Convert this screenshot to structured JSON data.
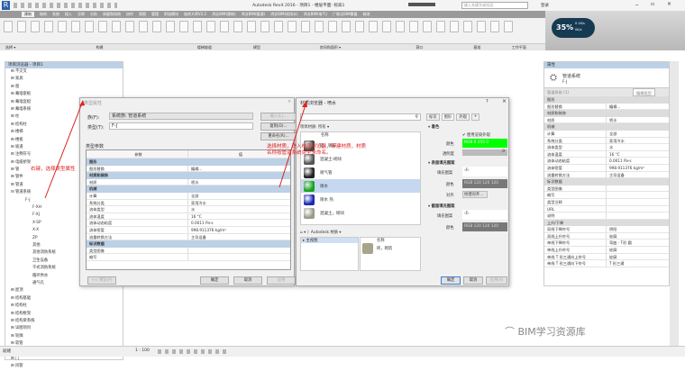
{
  "app": {
    "title": "Autodesk Revit 2016 -   项目1 - 楼层平面: 标高1",
    "search_placeholder": "键入关键字或短语",
    "user": "登录"
  },
  "ribbon": {
    "tabs": [
      "建筑",
      "结构",
      "系统",
      "插入",
      "注释",
      "分析",
      "体量和场地",
      "协作",
      "视图",
      "管理",
      "附加模块",
      "修改 | 管道",
      "族库大师V2.2",
      "鸿业BIM(建筑)",
      "鸿业BIM(暖通)",
      "鸿业BIM(给排水)",
      "鸿业BIM(电气)",
      "广联达BIM算量",
      "修改"
    ],
    "panels": [
      "选择 ▾",
      "构建",
      "楼梯坡道",
      "模型",
      "房间和面积 ▾",
      "洞口",
      "基准",
      "工作平面"
    ],
    "gauge": "35%",
    "gauge_up": "0.1K/s",
    "gauge_down": "0K/s"
  },
  "browser": {
    "title": "项目浏览器 - 项目1",
    "items": [
      "⊟ 管道系统",
      "⊞ 不交叉",
      "⊞ 家具",
      "⊞ 窗",
      "⊞ 幕墙嵌板",
      "⊞ 幕墙竖梃",
      "⊞ 幕墙系统",
      "⊞ 柱",
      "⊞ 结构柱",
      "⊞ 楼梯",
      "⊞ 楼板",
      "⊞ 坡道",
      "⊞ 注释符号",
      "⊞ 电缆桥架",
      "⊞ 管",
      "⊞ 管件",
      "⊞ 管道",
      "⊟ 管道系统"
    ],
    "sub": [
      "⊟ 管道系统",
      "F-J",
      "F-XH",
      "F-XJ",
      "X-SP",
      "X-X",
      "ZP",
      "其他",
      "其他消防系统",
      "卫生设备",
      "干式消防系统",
      "循环供水",
      "通气孔"
    ],
    "after": [
      "⊞ 屋顶",
      "⊞ 结构基础",
      "⊞ 结构柱",
      "⊞ 结构框架",
      "⊞ 结构梁系统",
      "⊞ 详图项目",
      "⊞ 轮廓",
      "⊞ 软管",
      "⊞ 软风管",
      "⊞ 门",
      "⊞ 风管"
    ]
  },
  "annotation1": "右键，选择类型属性",
  "annotation2": "选择材质，进入材质浏览器，新建材质，材质名称按管道系统类型来命名。",
  "type_dialog": {
    "title": "类型属性",
    "family_label": "族(F):",
    "family_value": "系统族: 管道系统",
    "type_label": "类型(T):",
    "type_value": "F-J",
    "load": "载入(L)...",
    "duplicate": "复制(D)...",
    "rename": "重命名(R)...",
    "params_label": "类型参数",
    "col_param": "参数",
    "col_value": "值",
    "groups": [
      {
        "name": "图形",
        "rows": [
          [
            "图形替换",
            "编辑..."
          ]
        ]
      },
      {
        "name": "材质和装饰",
        "rows": [
          [
            "材质",
            "喷水"
          ]
        ]
      },
      {
        "name": "机械",
        "rows": [
          [
            "计算",
            "全部"
          ],
          [
            "系统分类",
            "家用冷水"
          ],
          [
            "流体类型",
            "水"
          ],
          [
            "流体温度",
            "16 °C"
          ],
          [
            "流体动态粘度",
            "0.0011 Pa-s"
          ],
          [
            "流体密度",
            "998.911376 kg/m³"
          ],
          [
            "流量转换方法",
            "主导设备"
          ]
        ]
      },
      {
        "name": "标识数据",
        "rows": [
          [
            "类型图像",
            ""
          ],
          [
            "缩写",
            ""
          ]
        ]
      }
    ],
    "preview": "<< 预览(P)",
    "ok": "确定",
    "cancel": "取消",
    "apply": "应用"
  },
  "mat_dialog": {
    "title": "材质浏览器 - 喷水",
    "filter": "项目材质: 所有 ▾",
    "col_name": "名称",
    "materials": [
      {
        "name": "铝，镀锌",
        "color": "#444"
      },
      {
        "name": "混凝土-砌块",
        "color": "#555"
      },
      {
        "name": "喷气管",
        "color": "#222"
      },
      {
        "name": "喷水",
        "color": "#1aa31a"
      },
      {
        "name": "喷水 热",
        "color": "#1a2ab0"
      },
      {
        "name": "混凝土，砌块",
        "color": "#9a9a8c"
      }
    ],
    "lib": "Autodesk 材质 ▾",
    "lib_tree": "▸ 主视图",
    "lib_col": "名称",
    "lib_item": "砖，砌筑",
    "tabs": [
      "标识",
      "图形",
      "外观",
      "+"
    ],
    "sec_shading": "▾ 着色",
    "use_render": "✔ 使用渲染外观",
    "color_label": "颜色",
    "color_value": "RGB 0 255 0",
    "transp_label": "透明度",
    "transp_value": "0",
    "sec_surface": "▾ 表面填充图案",
    "fill_label": "填充图案",
    "fill_color_label": "颜色",
    "fill_color_value": "RGB 120 120 120",
    "align_label": "对齐",
    "align_value": "纹理对齐...",
    "sec_cut": "▾ 截面填充图案",
    "cut_fill_label": "填充图案",
    "cut_color_label": "颜色",
    "cut_color_value": "RGB 120 120 120",
    "ok": "确定",
    "cancel": "取消",
    "apply": "应用(A)",
    "help": "?",
    "close": "×"
  },
  "props": {
    "title": "属性",
    "type_name": "管道系统",
    "type_sub": "F-J",
    "selector": "管道系统 (1)",
    "edit_type": "编辑类型",
    "groups": [
      {
        "name": "图形",
        "rows": [
          [
            "图形替换",
            "编辑..."
          ]
        ]
      },
      {
        "name": "材质和装饰",
        "rows": [
          [
            "材质",
            "喷水"
          ]
        ]
      },
      {
        "name": "机械",
        "rows": [
          [
            "计算",
            "全部"
          ],
          [
            "系统分类",
            "家用冷水"
          ],
          [
            "流体类型",
            "水"
          ],
          [
            "流体温度",
            "16 °C"
          ],
          [
            "流体动态粘度",
            "0.0011 Pa-s"
          ],
          [
            "流体密度",
            "998.911376 kg/m³"
          ],
          [
            "流量转换方法",
            "主导设备"
          ]
        ]
      },
      {
        "name": "标识数据",
        "rows": [
          [
            "类型图像",
            ""
          ],
          [
            "缩写",
            ""
          ],
          [
            "类型注释",
            ""
          ],
          [
            "URL",
            ""
          ],
          [
            "说明",
            ""
          ]
        ]
      },
      {
        "name": "上升/下降",
        "rows": [
          [
            "双线下降符号",
            "阴阳"
          ],
          [
            "双线上升符号",
            "轮廓"
          ],
          [
            "单线下降符号",
            "弯曲 - T形 圆"
          ],
          [
            "单线上升符号",
            "轮廓"
          ],
          [
            "单线 T 形三通向上符号",
            "轮廓"
          ],
          [
            "单线 T 形三通向下符号",
            "T 形三通"
          ]
        ]
      }
    ]
  },
  "status": {
    "scale": "1 : 100",
    "ready": "就绪"
  },
  "watermark": "BIM学习资源库"
}
